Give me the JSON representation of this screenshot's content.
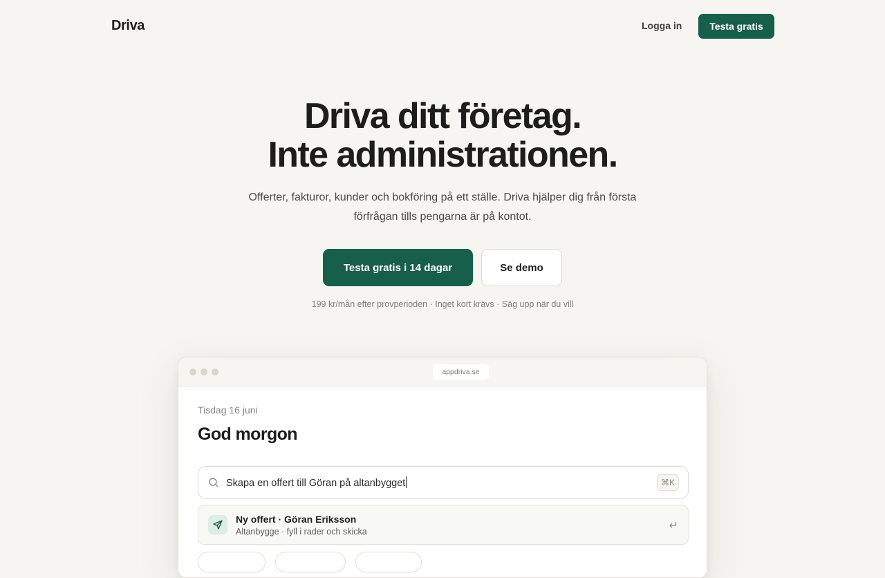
{
  "nav": {
    "logo": "Driva",
    "login_label": "Logga in",
    "cta_label": "Testa gratis"
  },
  "hero": {
    "title_line1": "Driva ditt företag.",
    "title_line2": "Inte administrationen.",
    "subtitle": "Offerter, fakturor, kunder och bokföring på ett ställe. Driva hjälper dig från första förfrågan tills pengarna är på kontot.",
    "primary_cta": "Testa gratis i 14 dagar",
    "secondary_cta": "Se demo",
    "fineprint": "199 kr/mån efter provperioden · Inget kort krävs · Säg upp när du vill"
  },
  "preview": {
    "url": "appdriva.se",
    "date": "Tisdag 16 juni",
    "greeting": "God morgon",
    "command_value": "Skapa en offert till Göran på altanbygget",
    "shortcut": "⌘K",
    "suggestion": {
      "title": "Ny offert · Göran Eriksson",
      "subtitle": "Altanbygge · fyll i rader och skicka",
      "enter_glyph": "↵"
    }
  },
  "colors": {
    "accent": "#175e4b",
    "background": "#f6f5f1"
  },
  "icons": [
    "search-icon",
    "send-icon",
    "enter-key-icon"
  ]
}
